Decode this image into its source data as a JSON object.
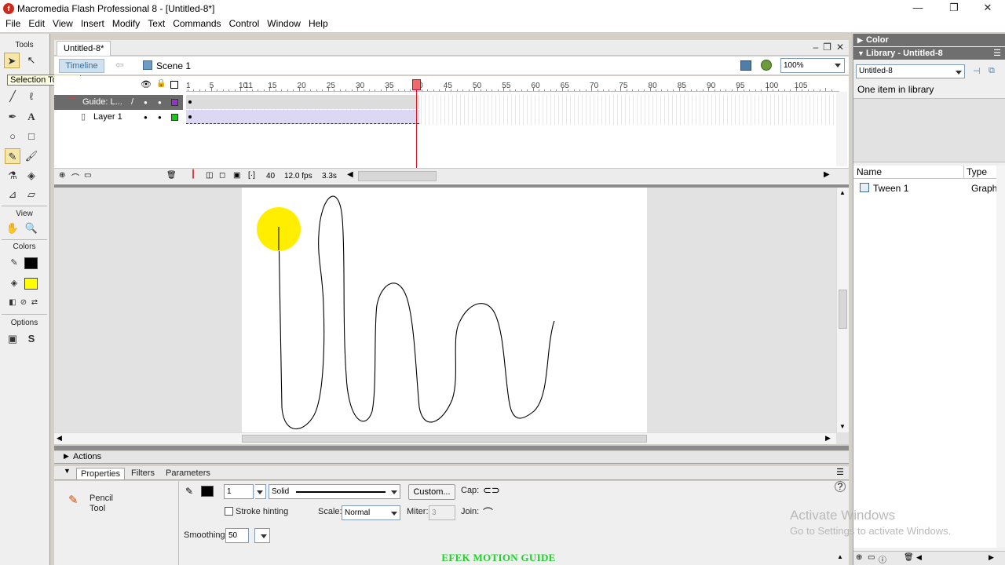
{
  "window": {
    "title": "Macromedia Flash Professional 8 - [Untitled-8*]",
    "minimize": "—",
    "maximize": "❐",
    "close": "✕"
  },
  "menu": [
    "File",
    "Edit",
    "View",
    "Insert",
    "Modify",
    "Text",
    "Commands",
    "Control",
    "Window",
    "Help"
  ],
  "tools": {
    "tools_label": "Tools",
    "view_label": "View",
    "colors_label": "Colors",
    "options_label": "Options",
    "tooltip": "Selection Tool (V)",
    "stroke_color": "#000000",
    "fill_color": "#ffff00"
  },
  "document": {
    "tab": "Untitled-8*",
    "timeline_button": "Timeline",
    "scene": "Scene 1",
    "zoom": "100%"
  },
  "timeline": {
    "ruler_labels": [
      "1",
      "5",
      "10",
      "15",
      "20",
      "25",
      "30",
      "35",
      "40",
      "45",
      "50",
      "55",
      "60",
      "65",
      "70",
      "75",
      "80",
      "85",
      "90",
      "95",
      "100",
      "105",
      "11"
    ],
    "layers": [
      {
        "name": "Guide: L...",
        "color": "#9b30d0",
        "selected": true
      },
      {
        "name": "Layer 1",
        "color": "#17c917",
        "selected": false
      }
    ],
    "current_frame": "40",
    "fps": "12.0 fps",
    "elapsed": "3.3s",
    "current_frame_value": 40,
    "last_frame_value": 40
  },
  "stage": {
    "ball_color": "#ffee00"
  },
  "actions": {
    "label": "Actions"
  },
  "properties": {
    "tabs": [
      "Properties",
      "Filters",
      "Parameters"
    ],
    "tool_name_line1": "Pencil",
    "tool_name_line2": "Tool",
    "stroke_height": "1",
    "stroke_style": "Solid",
    "custom_button": "Custom...",
    "cap_label": "Cap:",
    "stroke_hinting": "Stroke hinting",
    "scale_label": "Scale:",
    "scale_value": "Normal",
    "miter_label": "Miter:",
    "miter_value": "3",
    "join_label": "Join:",
    "smoothing_label": "Smoothing",
    "smoothing_value": "50"
  },
  "right_panels": {
    "color_header": "Color",
    "library_header": "Library - Untitled-8",
    "library_select": "Untitled-8",
    "item_count": "One item in library",
    "col_name": "Name",
    "col_type": "Type",
    "items": [
      {
        "name": "Tween 1",
        "type": "Graph"
      }
    ]
  },
  "watermark": {
    "line1": "Activate Windows",
    "line2": "Go to Settings to activate Windows."
  },
  "caption": "EFEK MOTION GUIDE"
}
